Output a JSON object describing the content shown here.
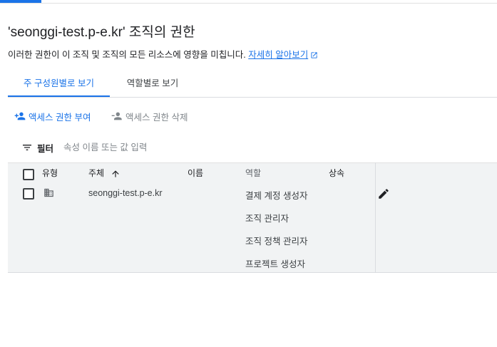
{
  "header": {
    "title": "'seonggi-test.p-e.kr' 조직의 권한",
    "subtitle": "이러한 권한이 이 조직 및 조직의 모든 리소스에 영향을 미칩니다.",
    "learn_more": "자세히 알아보기"
  },
  "tabs": [
    {
      "label": "주 구성원별로 보기",
      "active": true
    },
    {
      "label": "역할별로 보기",
      "active": false
    }
  ],
  "actions": {
    "grant": "액세스 권한 부여",
    "remove": "액세스 권한 삭제"
  },
  "filter": {
    "label": "필터",
    "placeholder": "속성 이름 또는 값 입력"
  },
  "table": {
    "columns": {
      "type": "유형",
      "principal": "주체",
      "name": "이름",
      "role": "역할",
      "inheritance": "상속"
    },
    "rows": [
      {
        "type_icon": "organization-icon",
        "principal": "seonggi-test.p-e.kr",
        "name": "",
        "roles": [
          "결제 계정 생성자",
          "조직 관리자",
          "조직 정책 관리자",
          "프로젝트 생성자"
        ],
        "inheritance": ""
      }
    ]
  },
  "colors": {
    "accent": "#1a73e8",
    "table_bg": "#f1f3f4",
    "text": "#202124",
    "muted": "#80868b"
  }
}
